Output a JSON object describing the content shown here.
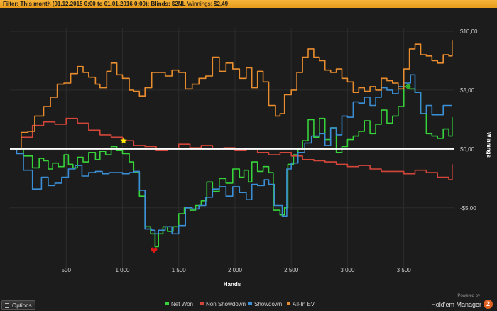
{
  "filter": {
    "label": "Filter:",
    "value": "This month (01.12.2015 0:00 to 01.01.2016 0:00); Blinds: $2NL",
    "winnings_label": "Winnings:",
    "winnings_value": "$2,49"
  },
  "footer": {
    "options_label": "Options",
    "powered_by": "Powered by",
    "brand": "Hold'em Manager",
    "brand_logo": "2"
  },
  "colors": {
    "background": "#1c1c1c",
    "net_won": "#37d33a",
    "non_showdown": "#d4463a",
    "showdown": "#3a8fd6",
    "all_in_ev": "#e98d2e",
    "zero_line": "#ffffff",
    "marker_star": "#ffe600",
    "marker_heart": "#e01818"
  },
  "chart_data": {
    "type": "line",
    "xlabel": "Hands",
    "ylabel": "Winnings",
    "x_ticks": [
      "500",
      "1 000",
      "1 500",
      "2 000",
      "2 500",
      "3 000",
      "3 500"
    ],
    "x_tick_values": [
      500,
      1000,
      1500,
      2000,
      2500,
      3000,
      3500
    ],
    "y_ticks": [
      "$10,00",
      "$5,00",
      "$0,00",
      "-$5,00"
    ],
    "y_tick_values": [
      10,
      5,
      0,
      -5
    ],
    "xlim": [
      0,
      3950
    ],
    "ylim": [
      -10.5,
      10.3
    ],
    "legend_position": "bottom-center",
    "series": [
      {
        "name": "Net Won",
        "color": "#37d33a",
        "points": [
          [
            0,
            0
          ],
          [
            60,
            0
          ],
          [
            120,
            -0.6
          ],
          [
            200,
            -1.6
          ],
          [
            260,
            -0.8
          ],
          [
            300,
            -1.0
          ],
          [
            340,
            -1.7
          ],
          [
            380,
            -1.2
          ],
          [
            430,
            -1.5
          ],
          [
            480,
            -0.5
          ],
          [
            520,
            -1.3
          ],
          [
            560,
            -1.6
          ],
          [
            600,
            -0.7
          ],
          [
            650,
            -1.1
          ],
          [
            700,
            -0.3
          ],
          [
            760,
            -0.9
          ],
          [
            800,
            -0.2
          ],
          [
            850,
            -0.5
          ],
          [
            900,
            0.2
          ],
          [
            950,
            -0.1
          ],
          [
            1000,
            -0.4
          ],
          [
            1060,
            -1.1
          ],
          [
            1100,
            -2.0
          ],
          [
            1150,
            -4.0
          ],
          [
            1200,
            -6.6
          ],
          [
            1250,
            -7.2
          ],
          [
            1290,
            -8.3
          ],
          [
            1320,
            -7.2
          ],
          [
            1360,
            -6.6
          ],
          [
            1400,
            -7.0
          ],
          [
            1450,
            -6.6
          ],
          [
            1500,
            -5.5
          ],
          [
            1550,
            -5.0
          ],
          [
            1600,
            -5.2
          ],
          [
            1650,
            -4.8
          ],
          [
            1700,
            -4.4
          ],
          [
            1750,
            -2.8
          ],
          [
            1800,
            -3.6
          ],
          [
            1860,
            -2.5
          ],
          [
            1920,
            -2.9
          ],
          [
            1980,
            -1.7
          ],
          [
            2040,
            -2.4
          ],
          [
            2080,
            -1.8
          ],
          [
            2120,
            -2.8
          ],
          [
            2150,
            -1.1
          ],
          [
            2200,
            -1.9
          ],
          [
            2250,
            -1.5
          ],
          [
            2300,
            -2.0
          ],
          [
            2340,
            -5.2
          ],
          [
            2400,
            -5.6
          ],
          [
            2440,
            -5.0
          ],
          [
            2470,
            -1.3
          ],
          [
            2520,
            -0.5
          ],
          [
            2560,
            0
          ],
          [
            2600,
            0.7
          ],
          [
            2650,
            2.5
          ],
          [
            2700,
            1.0
          ],
          [
            2750,
            2.6
          ],
          [
            2800,
            0.8
          ],
          [
            2850,
            1.8
          ],
          [
            2900,
            -0.3
          ],
          [
            2950,
            0.2
          ],
          [
            3000,
            0.8
          ],
          [
            3050,
            1.1
          ],
          [
            3100,
            1.5
          ],
          [
            3150,
            2.4
          ],
          [
            3200,
            1.3
          ],
          [
            3250,
            2.1
          ],
          [
            3300,
            3.3
          ],
          [
            3350,
            2.2
          ],
          [
            3400,
            2.8
          ],
          [
            3450,
            3.6
          ],
          [
            3500,
            5.3
          ],
          [
            3550,
            5.1
          ],
          [
            3600,
            4.8
          ],
          [
            3650,
            3.0
          ],
          [
            3700,
            1.3
          ],
          [
            3750,
            1.1
          ],
          [
            3800,
            0.9
          ],
          [
            3850,
            1.7
          ],
          [
            3900,
            1.1
          ],
          [
            3930,
            2.7
          ]
        ]
      },
      {
        "name": "Non Showdown",
        "color": "#d4463a",
        "points": [
          [
            0,
            0
          ],
          [
            100,
            1.0
          ],
          [
            200,
            2.0
          ],
          [
            300,
            2.3
          ],
          [
            400,
            2.1
          ],
          [
            500,
            2.6
          ],
          [
            600,
            2.2
          ],
          [
            700,
            1.6
          ],
          [
            800,
            1.2
          ],
          [
            900,
            1.0
          ],
          [
            1000,
            0.7
          ],
          [
            1100,
            0.3
          ],
          [
            1200,
            0.2
          ],
          [
            1300,
            -0.1
          ],
          [
            1400,
            0.0
          ],
          [
            1500,
            0.4
          ],
          [
            1600,
            0.1
          ],
          [
            1700,
            0.3
          ],
          [
            1800,
            0.0
          ],
          [
            1900,
            0.1
          ],
          [
            2000,
            -0.1
          ],
          [
            2100,
            0.0
          ],
          [
            2200,
            -0.3
          ],
          [
            2300,
            -0.5
          ],
          [
            2400,
            -0.3
          ],
          [
            2500,
            -0.6
          ],
          [
            2600,
            -0.9
          ],
          [
            2700,
            -1.0
          ],
          [
            2800,
            -1.1
          ],
          [
            2900,
            -1.3
          ],
          [
            3000,
            -1.5
          ],
          [
            3100,
            -1.4
          ],
          [
            3200,
            -1.7
          ],
          [
            3300,
            -1.9
          ],
          [
            3400,
            -1.9
          ],
          [
            3500,
            -2.1
          ],
          [
            3600,
            -1.8
          ],
          [
            3700,
            -2.0
          ],
          [
            3800,
            -2.4
          ],
          [
            3900,
            -2.6
          ],
          [
            3930,
            -1.3
          ]
        ]
      },
      {
        "name": "Showdown",
        "color": "#3a8fd6",
        "points": [
          [
            0,
            0
          ],
          [
            60,
            -0.4
          ],
          [
            120,
            -1.8
          ],
          [
            200,
            -3.4
          ],
          [
            280,
            -2.4
          ],
          [
            340,
            -3.1
          ],
          [
            400,
            -2.9
          ],
          [
            460,
            -2.4
          ],
          [
            520,
            -1.7
          ],
          [
            580,
            -1.4
          ],
          [
            640,
            -2.3
          ],
          [
            700,
            -2.0
          ],
          [
            760,
            -1.9
          ],
          [
            820,
            -2.1
          ],
          [
            880,
            -2.0
          ],
          [
            950,
            -2.0
          ],
          [
            1000,
            -2.1
          ],
          [
            1060,
            -2.0
          ],
          [
            1100,
            -1.9
          ],
          [
            1150,
            -3.5
          ],
          [
            1200,
            -6.8
          ],
          [
            1260,
            -6.9
          ],
          [
            1290,
            -7.2
          ],
          [
            1320,
            -6.9
          ],
          [
            1380,
            -6.6
          ],
          [
            1440,
            -7.2
          ],
          [
            1500,
            -6.5
          ],
          [
            1560,
            -5.0
          ],
          [
            1620,
            -5.1
          ],
          [
            1680,
            -4.8
          ],
          [
            1740,
            -4.1
          ],
          [
            1800,
            -3.4
          ],
          [
            1860,
            -3.2
          ],
          [
            1920,
            -4.0
          ],
          [
            1980,
            -3.2
          ],
          [
            2040,
            -3.7
          ],
          [
            2100,
            -4.3
          ],
          [
            2150,
            -3.0
          ],
          [
            2200,
            -3.1
          ],
          [
            2260,
            -2.6
          ],
          [
            2300,
            -3.0
          ],
          [
            2350,
            -4.8
          ],
          [
            2420,
            -5.7
          ],
          [
            2460,
            -1.7
          ],
          [
            2500,
            -1.2
          ],
          [
            2560,
            -0.3
          ],
          [
            2620,
            0.5
          ],
          [
            2680,
            1.1
          ],
          [
            2750,
            1.3
          ],
          [
            2800,
            0.3
          ],
          [
            2850,
            1.8
          ],
          [
            2900,
            1.2
          ],
          [
            2950,
            2.8
          ],
          [
            3000,
            2.7
          ],
          [
            3050,
            4.0
          ],
          [
            3100,
            3.9
          ],
          [
            3150,
            4.4
          ],
          [
            3200,
            3.7
          ],
          [
            3250,
            4.4
          ],
          [
            3300,
            5.2
          ],
          [
            3350,
            5.0
          ],
          [
            3400,
            4.7
          ],
          [
            3450,
            5.3
          ],
          [
            3500,
            5.6
          ],
          [
            3560,
            6.3
          ],
          [
            3600,
            4.8
          ],
          [
            3650,
            3.0
          ],
          [
            3700,
            3.7
          ],
          [
            3750,
            2.9
          ],
          [
            3800,
            2.9
          ],
          [
            3850,
            3.7
          ],
          [
            3930,
            3.7
          ]
        ]
      },
      {
        "name": "All-In EV",
        "color": "#e98d2e",
        "points": [
          [
            0,
            0
          ],
          [
            100,
            1.4
          ],
          [
            160,
            1.5
          ],
          [
            220,
            2.8
          ],
          [
            300,
            3.6
          ],
          [
            360,
            4.4
          ],
          [
            420,
            5.5
          ],
          [
            480,
            5.6
          ],
          [
            540,
            6.4
          ],
          [
            600,
            7.0
          ],
          [
            650,
            6.5
          ],
          [
            700,
            6.1
          ],
          [
            760,
            5.5
          ],
          [
            800,
            5.2
          ],
          [
            860,
            6.6
          ],
          [
            900,
            7.3
          ],
          [
            950,
            6.3
          ],
          [
            1000,
            6.0
          ],
          [
            1060,
            5.0
          ],
          [
            1100,
            4.9
          ],
          [
            1150,
            4.5
          ],
          [
            1200,
            5.2
          ],
          [
            1260,
            6.5
          ],
          [
            1320,
            6.5
          ],
          [
            1380,
            6.2
          ],
          [
            1440,
            6.7
          ],
          [
            1500,
            6.5
          ],
          [
            1560,
            5.1
          ],
          [
            1620,
            5.5
          ],
          [
            1680,
            6.0
          ],
          [
            1740,
            6.2
          ],
          [
            1800,
            7.8
          ],
          [
            1860,
            6.6
          ],
          [
            1920,
            7.3
          ],
          [
            1980,
            6.8
          ],
          [
            2040,
            6.0
          ],
          [
            2100,
            6.9
          ],
          [
            2150,
            5.2
          ],
          [
            2200,
            6.6
          ],
          [
            2250,
            5.7
          ],
          [
            2300,
            3.7
          ],
          [
            2360,
            2.8
          ],
          [
            2400,
            3.0
          ],
          [
            2440,
            4.6
          ],
          [
            2500,
            5.0
          ],
          [
            2550,
            6.5
          ],
          [
            2600,
            7.8
          ],
          [
            2650,
            8.5
          ],
          [
            2700,
            7.8
          ],
          [
            2750,
            7.5
          ],
          [
            2800,
            6.7
          ],
          [
            2850,
            6.5
          ],
          [
            2900,
            6.8
          ],
          [
            2950,
            6.0
          ],
          [
            3000,
            5.7
          ],
          [
            3050,
            4.8
          ],
          [
            3100,
            5.2
          ],
          [
            3150,
            4.9
          ],
          [
            3200,
            5.3
          ],
          [
            3250,
            5.0
          ],
          [
            3300,
            6.0
          ],
          [
            3350,
            5.8
          ],
          [
            3400,
            5.6
          ],
          [
            3450,
            5.1
          ],
          [
            3500,
            6.8
          ],
          [
            3550,
            8.5
          ],
          [
            3600,
            8.9
          ],
          [
            3650,
            8.0
          ],
          [
            3700,
            7.9
          ],
          [
            3750,
            7.5
          ],
          [
            3800,
            7.3
          ],
          [
            3850,
            8.0
          ],
          [
            3900,
            7.9
          ],
          [
            3930,
            9.2
          ]
        ]
      }
    ],
    "markers": [
      {
        "type": "star",
        "x": 1010,
        "y": 0.7,
        "color": "#ffe600"
      },
      {
        "type": "heart",
        "x": 1280,
        "y": -8.6,
        "color": "#e01818"
      },
      {
        "type": "circle",
        "x": 3540,
        "y": 5.3,
        "color": "#2fae2f"
      }
    ]
  }
}
